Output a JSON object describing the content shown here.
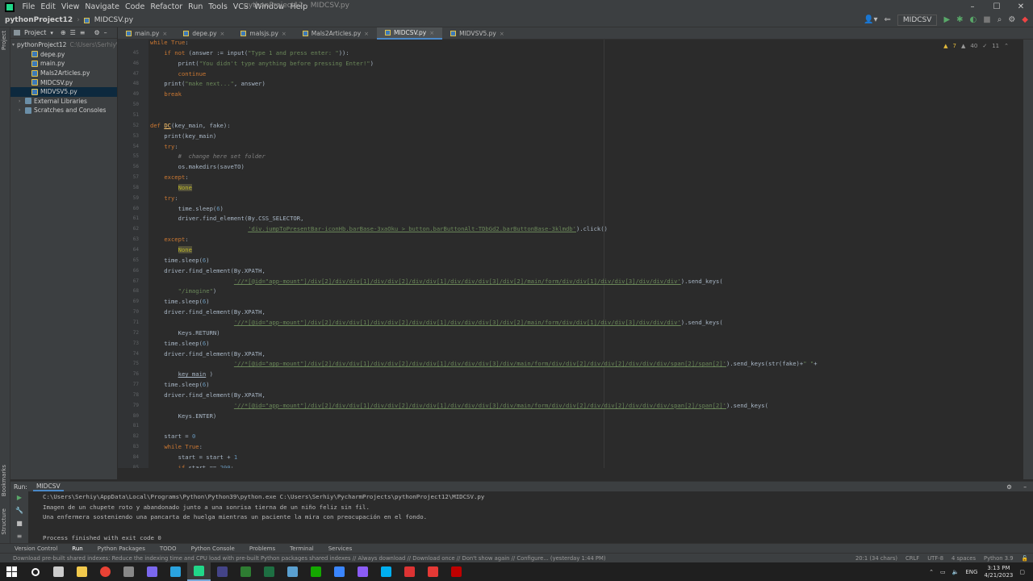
{
  "menubar": {
    "items": [
      "File",
      "Edit",
      "View",
      "Navigate",
      "Code",
      "Refactor",
      "Run",
      "Tools",
      "VCS",
      "Window",
      "Help"
    ],
    "title": "pythonProject12 - MIDCSV.py"
  },
  "navbar": {
    "project": "pythonProject12",
    "file": "MIDCSV.py",
    "run_config": "MIDCSV"
  },
  "project_panel": {
    "title": "Project",
    "tree": [
      {
        "label": "pythonProject12",
        "hint": "C:\\Users\\Serhiy\\",
        "type": "folder",
        "indent": 0
      },
      {
        "label": "depe.py",
        "type": "py",
        "indent": 2
      },
      {
        "label": "main.py",
        "type": "py",
        "indent": 2
      },
      {
        "label": "Mals2Articles.py",
        "type": "py",
        "indent": 2
      },
      {
        "label": "MIDCSV.py",
        "type": "py",
        "indent": 2
      },
      {
        "label": "MIDVSV5.py",
        "type": "py",
        "indent": 2,
        "selected": true
      },
      {
        "label": "External Libraries",
        "type": "lib",
        "indent": 1
      },
      {
        "label": "Scratches and Consoles",
        "type": "lib",
        "indent": 1
      }
    ]
  },
  "tabs": [
    {
      "label": "main.py",
      "active": false
    },
    {
      "label": "depe.py",
      "active": false
    },
    {
      "label": "malsjs.py",
      "active": false
    },
    {
      "label": "Mals2Articles.py",
      "active": false
    },
    {
      "label": "MIDCSV.py",
      "active": true
    },
    {
      "label": "MIDVSV5.py",
      "active": false
    }
  ],
  "inspection": {
    "warnings": "7",
    "weak": "40",
    "typos": "11"
  },
  "code_lines": [
    {
      "ln": "",
      "html": "<span class=\"kw\">while True</span>:"
    },
    {
      "ln": "45",
      "html": "    <span class=\"kw\">if not</span> (answer := input(<span class=\"str\">\"Type 1 and press enter: \"</span>)):"
    },
    {
      "ln": "46",
      "html": "        print(<span class=\"str\">\"You didn't type anything before pressing Enter!\"</span>)"
    },
    {
      "ln": "47",
      "html": "        <span class=\"kw\">continue</span>"
    },
    {
      "ln": "48",
      "html": "    print(<span class=\"str\">\"make next...\"</span>, answer)"
    },
    {
      "ln": "49",
      "html": "    <span class=\"kw\">break</span>"
    },
    {
      "ln": "50",
      "html": ""
    },
    {
      "ln": "51",
      "html": ""
    },
    {
      "ln": "52",
      "html": "<span class=\"kw\">def</span> <span class=\"fn\">DC</span>(key_main, fake):"
    },
    {
      "ln": "53",
      "html": "    print(key_main)"
    },
    {
      "ln": "54",
      "html": "    <span class=\"kw\">try</span>:"
    },
    {
      "ln": "55",
      "html": "        <span class=\"cm\">#  change here set folder</span>"
    },
    {
      "ln": "56",
      "html": "        os.makedirs(saveTO)"
    },
    {
      "ln": "57",
      "html": "    <span class=\"kw\">except</span>:"
    },
    {
      "ln": "58",
      "html": "        <span class=\"hl\">None</span>"
    },
    {
      "ln": "59",
      "html": "    <span class=\"kw\">try</span>:"
    },
    {
      "ln": "60",
      "html": "        time.sleep(<span class=\"num\">6</span>)"
    },
    {
      "ln": "61",
      "html": "        driver.find_element(By.CSS_SELECTOR,"
    },
    {
      "ln": "62",
      "html": "                            <span class=\"strul\">'div.jumpToPresentBar-iconHb.barBase-3xaOku > button.barButtonAlt-TDbGd2.barButtonBase-3klmdb'</span>).click()"
    },
    {
      "ln": "63",
      "html": "    <span class=\"kw\">except</span>:"
    },
    {
      "ln": "64",
      "html": "        <span class=\"hl\">None</span>"
    },
    {
      "ln": "65",
      "html": "    time.sleep(<span class=\"num\">6</span>)"
    },
    {
      "ln": "66",
      "html": "    driver.find_element(By.XPATH,"
    },
    {
      "ln": "67",
      "html": "                        <span class=\"strul\">'//*[@id=\"app-mount\"]/div[2]/div/div[1]/div/div[2]/div/div[1]/div/div/div[3]/div[2]/main/form/div/div[1]/div/div[3]/div/div/div'</span>).send_keys("
    },
    {
      "ln": "68",
      "html": "        <span class=\"str\">\"/imagine\"</span>)"
    },
    {
      "ln": "69",
      "html": "    time.sleep(<span class=\"num\">6</span>)"
    },
    {
      "ln": "70",
      "html": "    driver.find_element(By.XPATH,"
    },
    {
      "ln": "71",
      "html": "                        <span class=\"strul\">'//*[@id=\"app-mount\"]/div[2]/div/div[1]/div/div[2]/div/div[1]/div/div/div[3]/div[2]/main/form/div/div[1]/div/div[3]/div/div/div'</span>).send_keys("
    },
    {
      "ln": "72",
      "html": "        Keys.RETURN)"
    },
    {
      "ln": "73",
      "html": "    time.sleep(<span class=\"num\">6</span>)"
    },
    {
      "ln": "74",
      "html": "    driver.find_element(By.XPATH,"
    },
    {
      "ln": "75",
      "html": "                        <span class=\"strul\">'//*[@id=\"app-mount\"]/div[2]/div/div[1]/div/div[2]/div/div[1]/div/div/div[3]/div/main/form/div/div[2]/div/div[2]/div/div/div/span[2]/span[2]'</span>).send_keys(str(fake)+<span class=\"str\">\" \"</span>+"
    },
    {
      "ln": "76",
      "html": "        <span style=\"text-decoration:underline\">key_main</span> )"
    },
    {
      "ln": "77",
      "html": "    time.sleep(<span class=\"num\">6</span>)"
    },
    {
      "ln": "78",
      "html": "    driver.find_element(By.XPATH,"
    },
    {
      "ln": "79",
      "html": "                        <span class=\"strul\">'//*[@id=\"app-mount\"]/div[2]/div/div[1]/div/div[2]/div/div[1]/div/div/div[3]/div/main/form/div/div[2]/div/div[2]/div/div/div/span[2]/span[2]'</span>).send_keys("
    },
    {
      "ln": "80",
      "html": "        Keys.ENTER)"
    },
    {
      "ln": "81",
      "html": ""
    },
    {
      "ln": "82",
      "html": "    start = <span class=\"num\">0</span>"
    },
    {
      "ln": "83",
      "html": "    <span class=\"kw\">while True</span>:"
    },
    {
      "ln": "84",
      "html": "        start = start + <span class=\"num\">1</span>"
    },
    {
      "ln": "85",
      "html": "        <span class=\"kw\">if</span> start == <span class=\"num\">200</span>:"
    }
  ],
  "run_panel": {
    "label": "Run:",
    "config": "MIDCSV",
    "output": [
      "C:\\Users\\Serhiy\\AppData\\Local\\Programs\\Python\\Python39\\python.exe C:\\Users\\Serhiy\\PycharmProjects\\pythonProject12\\MIDCSV.py",
      "Imagen de un chupete roto y abandonado junto a una sonrisa tierna de un niño feliz sin fil.",
      "Una enfermera sosteniendo una pancarta de huelga mientras un paciente la mira con preocupación en el fondo.",
      "",
      "Process finished with exit code 0"
    ]
  },
  "tool_tabs": [
    "Version Control",
    "Run",
    "Python Packages",
    "TODO",
    "Python Console",
    "Problems",
    "Terminal",
    "Services"
  ],
  "statusbar": {
    "message": "Download pre-built shared indexes: Reduce the indexing time and CPU load with pre-built Python packages shared indexes // Always download // Download once // Don't show again // Configure... (yesterday 1:44 PM)",
    "position": "20:1 (34 chars)",
    "line_sep": "CRLF",
    "encoding": "UTF-8",
    "indent": "4 spaces",
    "interpreter": "Python 3.9"
  },
  "taskbar": {
    "apps": [
      {
        "name": "search-icon",
        "color": "#ffffff"
      },
      {
        "name": "task-view-icon",
        "color": "#cccccc"
      },
      {
        "name": "file-explorer-icon",
        "color": "#f2c94c"
      },
      {
        "name": "chrome-icon",
        "color": "#e94235"
      },
      {
        "name": "app-icon",
        "color": "#888888"
      },
      {
        "name": "app-icon",
        "color": "#7b68ee"
      },
      {
        "name": "telegram-icon",
        "color": "#2aa3df"
      },
      {
        "name": "pycharm-icon",
        "color": "#21d789"
      },
      {
        "name": "app-icon",
        "color": "#444488"
      },
      {
        "name": "app-icon",
        "color": "#2e7d32"
      },
      {
        "name": "excel-icon",
        "color": "#1d6f42"
      },
      {
        "name": "app-icon",
        "color": "#5aa0d0"
      },
      {
        "name": "upwork-icon",
        "color": "#14a800"
      },
      {
        "name": "app-icon",
        "color": "#3a86ff"
      },
      {
        "name": "app-icon",
        "color": "#8b5cf6"
      },
      {
        "name": "skype-icon",
        "color": "#00aff0"
      },
      {
        "name": "app-icon",
        "color": "#d33"
      },
      {
        "name": "app-icon",
        "color": "#e53935"
      },
      {
        "name": "filezilla-icon",
        "color": "#bf0000"
      }
    ],
    "lang": "ENG",
    "time": "3:13 PM",
    "date": "4/21/2023"
  }
}
